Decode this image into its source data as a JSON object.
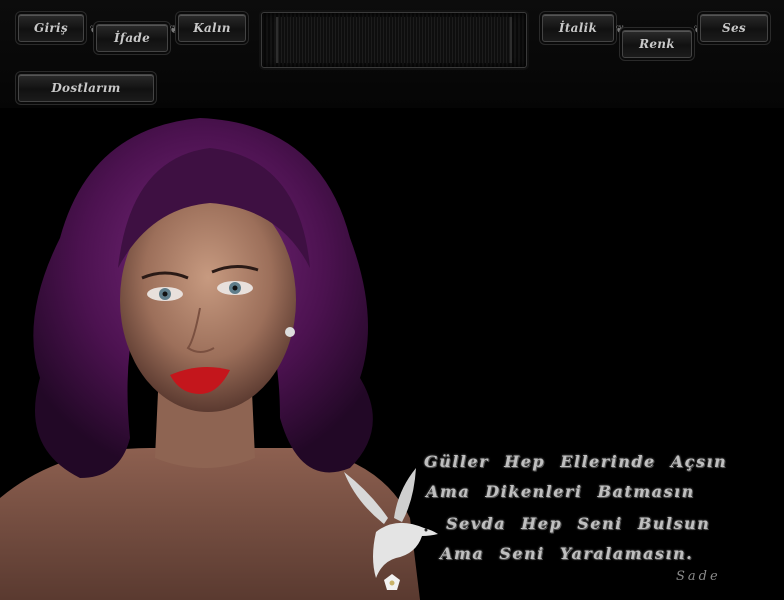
{
  "nav": {
    "left": [
      "Giriş",
      "İfade",
      "Kalın"
    ],
    "right": [
      "İtalik",
      "Renk",
      "Ses"
    ],
    "second_row": [
      "Dostlarım"
    ]
  },
  "poem": {
    "lines": [
      "Güller Hep Ellerinde Açsın",
      "Ama Dikenleri Batmasın",
      "Sevda Hep Seni Bulsun",
      "Ama Seni Yaralamasın."
    ],
    "signature": "Sade"
  },
  "colors": {
    "background": "#000000",
    "button_text": "#c8c8c8",
    "poem_text": "#bfbfbf",
    "lip": "#c4161c",
    "hair": "#5a1a5e"
  }
}
